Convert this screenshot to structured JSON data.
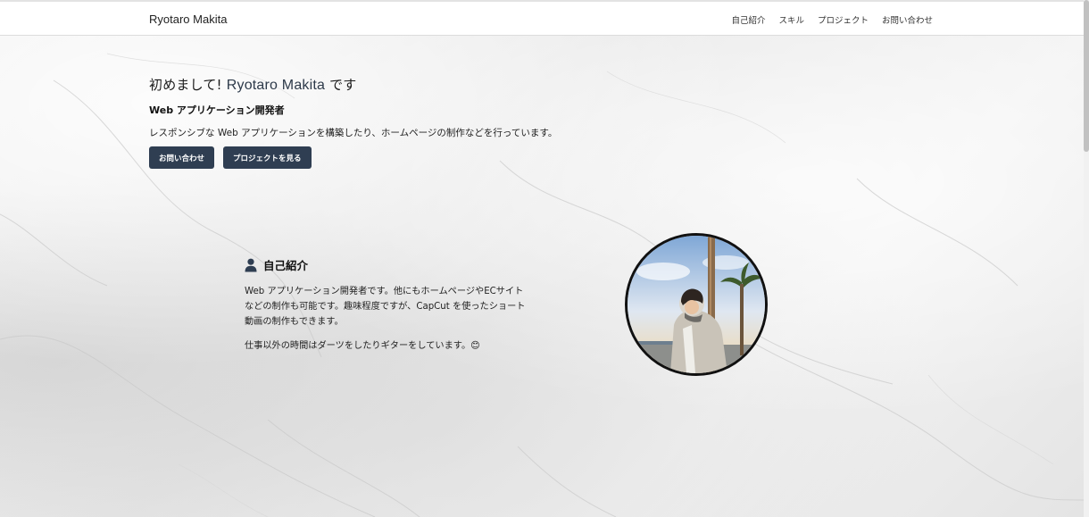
{
  "header": {
    "brand": "Ryotaro Makita",
    "nav": [
      "自己紹介",
      "スキル",
      "プロジェクト",
      "お問い合わせ"
    ]
  },
  "hero": {
    "greeting_prefix": "初めまして!",
    "name": "Ryotaro Makita",
    "greeting_suffix": "です",
    "role": "Web アプリケーション開発者",
    "lead": "レスポンシブな Web アプリケーションを構築したり、ホームページの制作などを行っています。",
    "buttons": {
      "contact": "お問い合わせ",
      "projects": "プロジェクトを見る"
    }
  },
  "about": {
    "title": "自己紹介",
    "paragraph1": "Web アプリケーション開発者です。他にもホームページやECサイトなどの制作も可能です。趣味程度ですが、CapCut を使ったショート動画の制作もできます。",
    "paragraph2": "仕事以外の時間はダーツをしたりギターをしています。😊",
    "icon": "user-icon"
  },
  "colors": {
    "button_bg": "#2f3e52",
    "name_color": "#2d3a4a"
  }
}
